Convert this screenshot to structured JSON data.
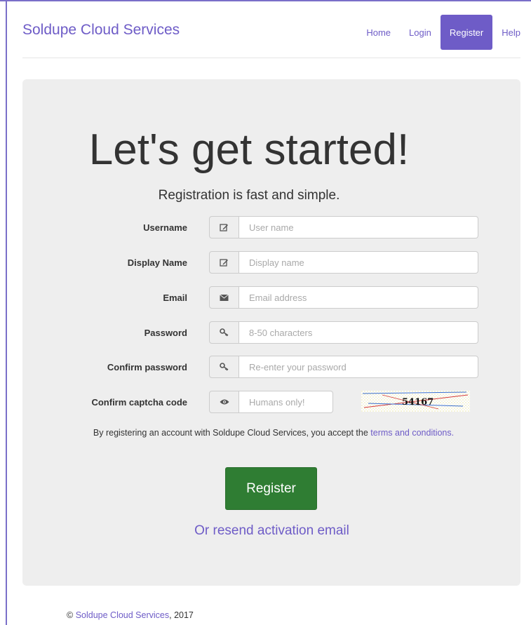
{
  "nav": {
    "brand": "Soldupe Cloud Services",
    "links": [
      "Home",
      "Login",
      "Register",
      "Help"
    ],
    "active": "Register"
  },
  "hero": {
    "heading": "Let's get started!",
    "lead": "Registration is fast and simple."
  },
  "form": {
    "fields": [
      {
        "label": "Username",
        "placeholder": "User name",
        "icon": "edit-icon"
      },
      {
        "label": "Display Name",
        "placeholder": "Display name",
        "icon": "edit-icon"
      },
      {
        "label": "Email",
        "placeholder": "Email address",
        "icon": "envelope-icon"
      },
      {
        "label": "Password",
        "placeholder": "8-50 characters",
        "icon": "key-icon"
      },
      {
        "label": "Confirm password",
        "placeholder": "Re-enter your password",
        "icon": "key-icon"
      },
      {
        "label": "Confirm captcha code",
        "placeholder": "Humans only!",
        "icon": "eye-icon"
      }
    ],
    "captcha_text": "54167",
    "terms_prefix": "By registering an account with Soldupe Cloud Services, you accept the ",
    "terms_link": "terms and conditions.",
    "submit": "Register",
    "resend": "Or resend activation email"
  },
  "footer": {
    "copyright": "©",
    "link": "Soldupe Cloud Services",
    "year_suffix": ", 2017"
  },
  "colors": {
    "accent": "#6e5cc7",
    "button": "#2f7d33",
    "panel": "#eeeeee"
  }
}
